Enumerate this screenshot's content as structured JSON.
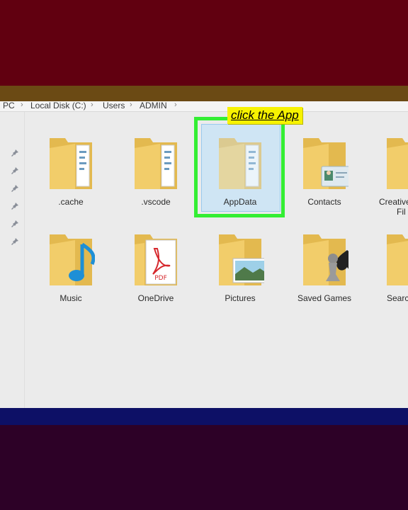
{
  "breadcrumb": [
    "PC",
    "Local Disk (C:)",
    "Users",
    "ADMIN"
  ],
  "callout": "click the App",
  "folders": [
    {
      "label": ".cache",
      "icon": "folder-icon"
    },
    {
      "label": ".vscode",
      "icon": "folder-icon"
    },
    {
      "label": "AppData",
      "icon": "folder-icon",
      "selected": true
    },
    {
      "label": "Contacts",
      "icon": "contacts-folder-icon"
    },
    {
      "label": "Creative",
      "sublabel": "Fil",
      "icon": "creative-cloud-folder-icon"
    },
    {
      "label": "Music",
      "icon": "music-folder-icon"
    },
    {
      "label": "OneDrive",
      "icon": "pdf-folder-icon"
    },
    {
      "label": "Pictures",
      "icon": "pictures-folder-icon"
    },
    {
      "label": "Saved Games",
      "icon": "saved-games-folder-icon"
    },
    {
      "label": "Searc",
      "icon": "search-folder-icon"
    }
  ],
  "colors": {
    "highlight": "#33ee33",
    "callout_bg": "#f7f200",
    "selection_bg": "#cfe5f4",
    "folder": "#f2cd6a"
  }
}
